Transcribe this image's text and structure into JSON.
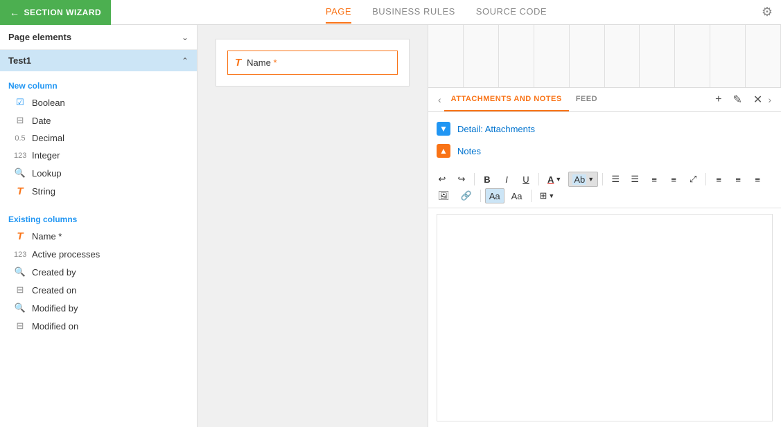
{
  "topbar": {
    "wizard_label": "SECTION WIZARD",
    "tabs": [
      {
        "id": "page",
        "label": "PAGE",
        "active": true
      },
      {
        "id": "business_rules",
        "label": "BUSINESS RULES",
        "active": false
      },
      {
        "id": "source_code",
        "label": "SOURCE CODE",
        "active": false
      }
    ]
  },
  "sidebar": {
    "page_elements_label": "Page elements",
    "group_label": "Test1",
    "new_columns_header": "New column",
    "new_columns": [
      {
        "id": "boolean",
        "label": "Boolean",
        "icon": "☑",
        "icon_class": "icon-boolean"
      },
      {
        "id": "date",
        "label": "Date",
        "icon": "▦",
        "icon_class": "icon-date"
      },
      {
        "id": "decimal",
        "label": "Decimal",
        "icon": "0.5",
        "icon_class": "icon-decimal"
      },
      {
        "id": "integer",
        "label": "Integer",
        "icon": "123",
        "icon_class": "icon-integer"
      },
      {
        "id": "lookup",
        "label": "Lookup",
        "icon": "⌕",
        "icon_class": "icon-lookup"
      },
      {
        "id": "string",
        "label": "String",
        "icon": "T",
        "icon_class": "icon-string"
      }
    ],
    "existing_columns_header": "Existing columns",
    "existing_columns": [
      {
        "id": "name",
        "label": "Name *",
        "icon": "T",
        "icon_class": "icon-name"
      },
      {
        "id": "active_processes",
        "label": "Active processes",
        "icon": "123",
        "icon_class": "icon-activeproc"
      },
      {
        "id": "created_by",
        "label": "Created by",
        "icon": "⌕",
        "icon_class": "icon-createdby"
      },
      {
        "id": "created_on",
        "label": "Created on",
        "icon": "▦",
        "icon_class": "icon-createdon"
      },
      {
        "id": "modified_by",
        "label": "Modified by",
        "icon": "⌕",
        "icon_class": "icon-modifiedby"
      },
      {
        "id": "modified_on",
        "label": "Modified on",
        "icon": "▦",
        "icon_class": "icon-modifiedon"
      }
    ]
  },
  "canvas": {
    "field_icon": "T",
    "field_label": "Name",
    "field_required": true
  },
  "right_panel": {
    "tabs": [
      {
        "id": "attachments_notes",
        "label": "ATTACHMENTS AND NOTES",
        "active": true
      },
      {
        "id": "feed",
        "label": "FEED",
        "active": false
      }
    ],
    "detail_attachments_label": "Detail: Attachments",
    "notes_label": "Notes",
    "toolbar": {
      "undo": "↩",
      "redo": "↪",
      "bold": "B",
      "italic": "I",
      "underline": "U",
      "font_color": "A",
      "highlight": "Ab",
      "ordered_list": "≡",
      "unordered_list": "≡",
      "indent_dec": "≡",
      "indent_inc": "≡",
      "expand": "⤢",
      "align_left": "≡",
      "align_center": "≡",
      "align_right": "≡",
      "image": "🖼",
      "link": "🔗",
      "font_aa": "Aa",
      "font_aa2": "Aa",
      "table": "⊞"
    }
  }
}
